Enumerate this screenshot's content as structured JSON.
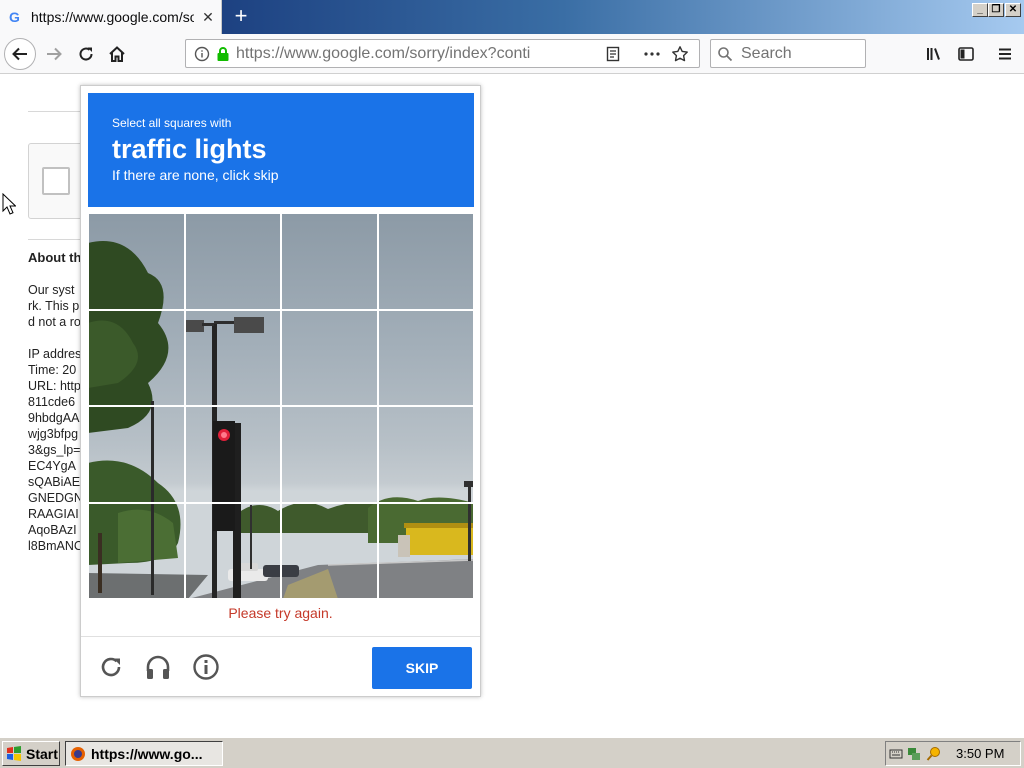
{
  "browser": {
    "tab": {
      "title": "https://www.google.com/sorry/index?continue",
      "favicon": "google-g-icon",
      "close_glyph": "✕"
    },
    "new_tab_glyph": "+",
    "window_controls": [
      "_",
      "❐",
      "✕"
    ],
    "url": "https://www.google.com/sorry/index?conti",
    "search": {
      "placeholder": "Search",
      "value": ""
    },
    "toolbar_icons": [
      "back-icon",
      "forward-icon",
      "reload-icon",
      "home-icon",
      "info-icon",
      "lock-icon",
      "reader-view-icon",
      "page-actions-icon",
      "bookmark-star-icon",
      "library-icon",
      "sidebar-icon",
      "menu-icon"
    ]
  },
  "background_page": {
    "heading": "About th",
    "lines": [
      "Our syst",
      "rk. This p",
      "d not a ro",
      "",
      "IP addres",
      "Time: 20",
      "URL: http",
      "811cde6",
      "9hbdgAA",
      "wjg3bfpg",
      "3&gs_lp=",
      "EC4YgA",
      "sQABiAE",
      "GNEDGN",
      "RAAGIAI",
      "AqoBAzI",
      "l8BmANC"
    ]
  },
  "challenge": {
    "instruction": "Select all squares with",
    "target": "traffic lights",
    "hint": "If there are none, click skip",
    "grid": {
      "rows": 4,
      "cols": 4
    },
    "error": "Please try again.",
    "skip_label": "SKIP",
    "footer_icons": [
      "reload-icon",
      "audio-headphones-icon",
      "info-icon"
    ],
    "colors": {
      "header": "#1a73e8",
      "button": "#1a73e8",
      "error": "#c53929"
    }
  },
  "taskbar": {
    "start_label": "Start",
    "task_label": "https://www.go...",
    "clock": "3:50 PM"
  }
}
